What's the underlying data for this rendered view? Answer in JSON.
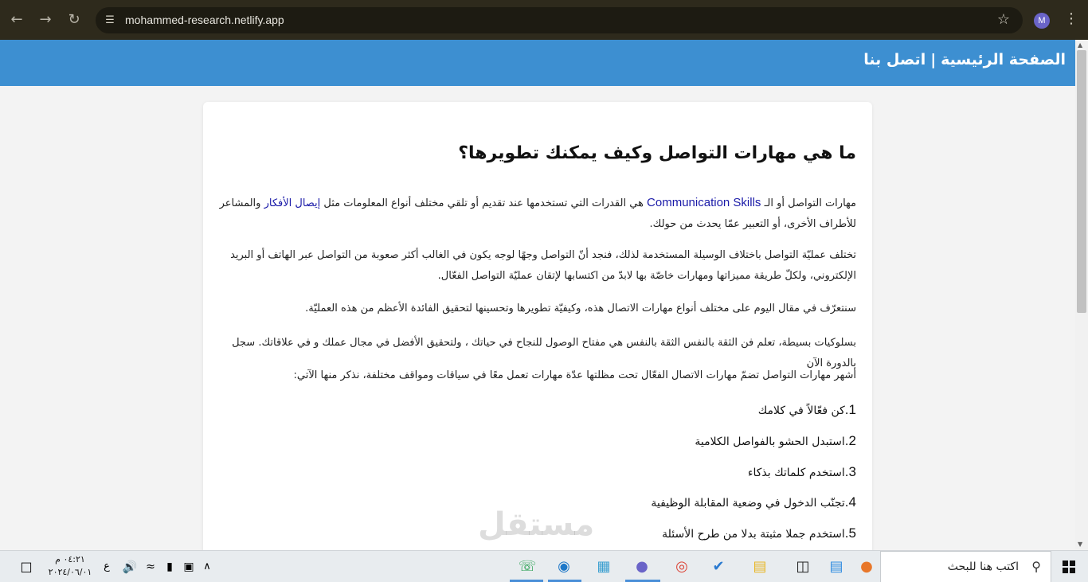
{
  "browser": {
    "url": "mohammed-research.netlify.app",
    "profile_initial": "M"
  },
  "site_header": {
    "home": "الصفحة الرئيسية",
    "separator": "|",
    "contact": "اتصل بنا"
  },
  "article": {
    "title": "ما هي مهارات التواصل وكيف يمكنك تطويرها؟",
    "p1_a": "مهارات التواصل أو الـ ",
    "p1_link1": "Communication Skills",
    "p1_b": " هي القدرات التي تستخدمها عند تقديم أو تلقي مختلف أنواع المعلومات مثل ",
    "p1_link2": "إيصال الأفكار",
    "p1_c": " والمشاعر للأطراف الأخرى، أو التعبير عمّا يحدث من حولك.",
    "p2": "تختلف عمليّة التواصل باختلاف الوسيلة المستخدمة لذلك، فنجد أنّ التواصل وجهًا لوجه يكون في الغالب أكثر صعوبة من التواصل عبر الهاتف أو البريد الإلكتروني، ولكلّ طريقة مميزاتها ومهارات خاصّة بها لابدّ من اكتسابها لإتقان عمليّة التواصل الفعّال.",
    "p3": "سنتعرّف في مقال اليوم على مختلف أنواع مهارات الاتصال هذه، وكيفيّة تطويرها وتحسينها لتحقيق الفائدة الأعظم من هذه العمليّة.",
    "p4": "بسلوكيات بسيطة، تعلم فن الثقة بالنفس الثقة بالنفس هي مفتاح الوصول للنجاح في حياتك ، ولتحقيق الأفضل في مجال عملك و في علاقاتك. سجل بالدورة الآن",
    "p5": "أشهر مهارات التواصل تضمّ مهارات الاتصال الفعّال تحت مظلتها عدّة مهارات تعمل معًا في سياقات ومواقف مختلفة، نذكر منها الآتي:",
    "steps": [
      {
        "num": "1.",
        "text": "كن فعّالاً في كلامك"
      },
      {
        "num": "2.",
        "text": "استبدل الحشو بالفواصل الكلامية"
      },
      {
        "num": "3.",
        "text": "استخدم كلماتك بذكاء"
      },
      {
        "num": "4.",
        "text": "تجنّب الدخول في وضعية المقابلة الوظيفية"
      },
      {
        "num": "5.",
        "text": "استخدم جملا مثبتة بدلا من طرح الأسئلة"
      }
    ]
  },
  "watermark": "مستقل",
  "taskbar": {
    "search_placeholder": "اكتب هنا للبحث",
    "time": "٠٤:٢١ م",
    "date": "٢٠٢٤/٠٦/٠١",
    "lang": "ع"
  }
}
